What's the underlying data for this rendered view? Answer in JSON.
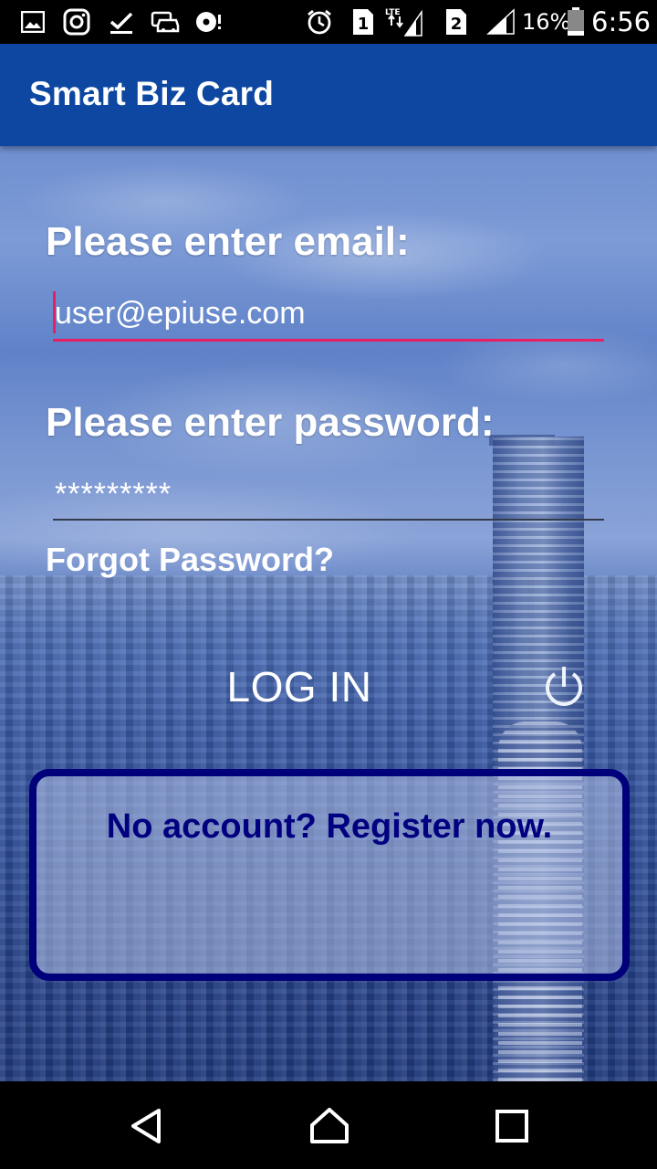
{
  "status_bar": {
    "sim1": "1",
    "sim2": "2",
    "network": "LTE",
    "battery": "16%",
    "time": "6:56"
  },
  "app_bar": {
    "title": "Smart Biz Card"
  },
  "form": {
    "email_label": "Please enter email:",
    "email_value": "user@epiuse.com",
    "password_label": "Please enter password:",
    "password_value": "*********",
    "forgot_label": "Forgot Password?",
    "login_label": "LOG IN",
    "register_label": "No account? Register now."
  },
  "colors": {
    "app_bar": "#0D47A1",
    "accent": "#E91E63",
    "register_border": "#00007A",
    "register_text": "#000080"
  },
  "icons": {
    "status_left": [
      "image-icon",
      "instagram-icon",
      "check-icon",
      "car-icon",
      "media-icon"
    ],
    "status_right": [
      "alarm-icon",
      "sim1-icon",
      "signal-icon",
      "sim2-icon",
      "signal-icon",
      "battery-icon"
    ],
    "login": "power-icon",
    "nav": [
      "back-icon",
      "home-icon",
      "recents-icon"
    ]
  }
}
